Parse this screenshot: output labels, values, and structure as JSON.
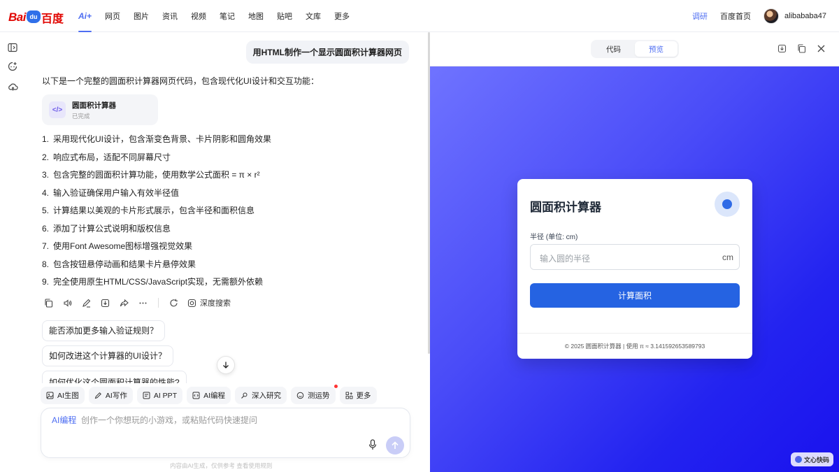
{
  "topbar": {
    "logo_bai": "Bai",
    "logo_du": "du",
    "logo_cn": "百度",
    "nav": [
      "Ai+",
      "网页",
      "图片",
      "资讯",
      "视频",
      "笔记",
      "地图",
      "贴吧",
      "文库",
      "更多"
    ],
    "survey": "调研",
    "home": "百度首页",
    "username": "alibababa47"
  },
  "chat": {
    "user_message": "用HTML制作一个显示圆面积计算器网页",
    "intro": "以下是一个完整的圆面积计算器网页代码，包含现代化UI设计和交互功能：",
    "code_card": {
      "title": "圆面积计算器",
      "status": "已完成"
    },
    "points": [
      "采用现代化UI设计，包含渐变色背景、卡片阴影和圆角效果",
      "响应式布局，适配不同屏幕尺寸",
      "包含完整的圆面积计算功能，使用数学公式面积 = π × r²",
      "输入验证确保用户输入有效半径值",
      "计算结果以美观的卡片形式展示，包含半径和面积信息",
      "添加了计算公式说明和版权信息",
      "使用Font Awesome图标增强视觉效果",
      "包含按钮悬停动画和结果卡片悬停效果",
      "完全使用原生HTML/CSS/JavaScript实现，无需额外依赖"
    ],
    "point_numbers": [
      "1.",
      "2.",
      "3.",
      "4.",
      "5.",
      "6.",
      "7.",
      "8.",
      "9."
    ],
    "deep_search": "深度搜索",
    "suggestions": [
      "能否添加更多输入验证规则？",
      "如何改进这个计算器的UI设计？",
      "如何优化这个圆面积计算器的性能?"
    ],
    "tools": [
      "AI生图",
      "AI写作",
      "AI PPT",
      "AI编程",
      "深入研究",
      "测运势",
      "更多"
    ],
    "input_prefix": "AI编程",
    "input_placeholder": "创作一个你想玩的小游戏，或粘贴代码快速提问",
    "footer_note": "内容由AI生成，仅供参考   查看使用规则"
  },
  "panel": {
    "tabs": [
      "代码",
      "预览"
    ],
    "active_tab": "预览",
    "calculator": {
      "title": "圆面积计算器",
      "label": "半径 (单位: cm)",
      "placeholder": "输入圆的半径",
      "unit": "cm",
      "button": "计算面积",
      "footer": "© 2025 圆面积计算器 | 使用 π ≈ 3.141592653589793"
    },
    "brand_badge": "文心快码"
  },
  "colors": {
    "accent": "#4e6ef2",
    "logo_red": "#e10602",
    "calc_button": "#2563e2",
    "preview_gradient_start": "#6f73ff",
    "preview_gradient_end": "#1a12ee"
  }
}
